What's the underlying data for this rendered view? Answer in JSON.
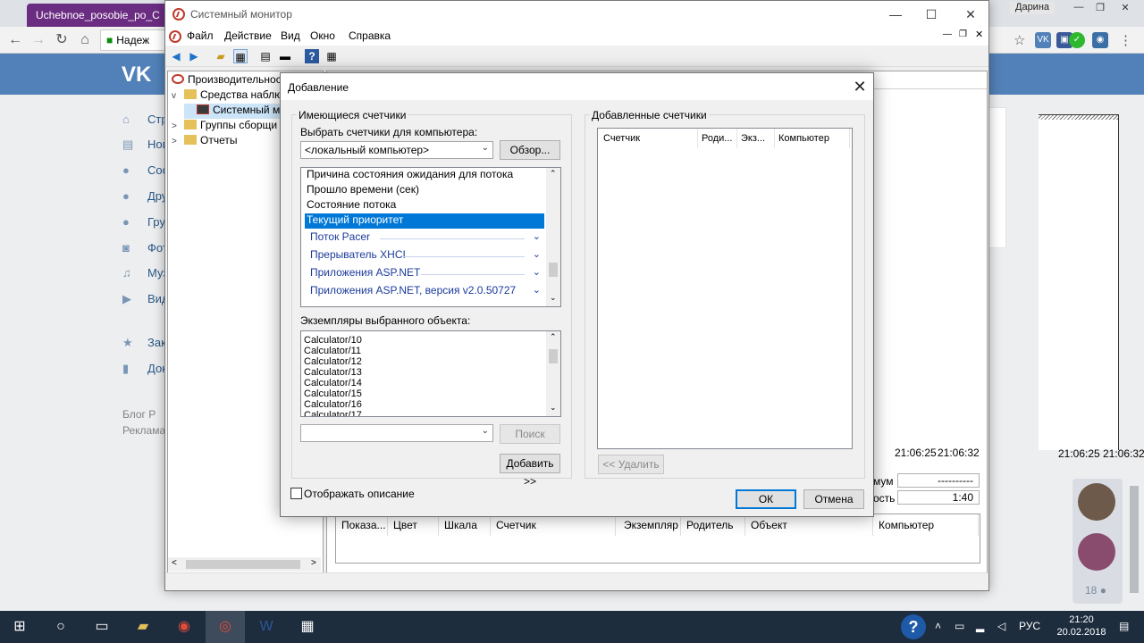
{
  "browser": {
    "tab_title": "Uchebnoe_posobie_po_C",
    "address_text": "Надеж",
    "user_name": "Дарина"
  },
  "vk": {
    "logo": "VK",
    "menu": [
      {
        "label": "Стр",
        "icon": "home-icon"
      },
      {
        "label": "Нов",
        "icon": "news-icon"
      },
      {
        "label": "Соо",
        "icon": "messages-icon"
      },
      {
        "label": "Дру",
        "icon": "friends-icon"
      },
      {
        "label": "Гру",
        "icon": "groups-icon"
      },
      {
        "label": "Фот",
        "icon": "camera-icon"
      },
      {
        "label": "Муз",
        "icon": "music-icon"
      },
      {
        "label": "Вид",
        "icon": "video-icon"
      },
      {
        "label": "Зак",
        "icon": "bookmark-icon"
      },
      {
        "label": "Док",
        "icon": "document-icon"
      }
    ],
    "footer_line1": "Блог   Р",
    "footer_line2": "Реклама",
    "friends_count": "18"
  },
  "perfmon": {
    "title": "Системный монитор",
    "menu": [
      "Файл",
      "Действие",
      "Вид",
      "Окно",
      "Справка"
    ],
    "tree": [
      {
        "label": "Производительност",
        "level": 0,
        "expander": ""
      },
      {
        "label": "Средства наблюд",
        "level": 1,
        "expander": "v"
      },
      {
        "label": "Системный м",
        "level": 2,
        "expander": ""
      },
      {
        "label": "Группы сборщи",
        "level": 1,
        "expander": ">"
      },
      {
        "label": "Отчеты",
        "level": 1,
        "expander": ">"
      }
    ],
    "graph_times": [
      "21:06:25",
      "21:06:32"
    ],
    "stats": [
      {
        "label": "мум",
        "value": "----------"
      },
      {
        "label": "ость",
        "value": "1:40"
      }
    ],
    "columns": [
      "Показа...",
      "Цвет",
      "Шкала",
      "Счетчик",
      "Экземпляр",
      "Родитель",
      "Объект",
      "Компьютер"
    ]
  },
  "dialog": {
    "title": "Добавление",
    "available_group": "Имеющиеся счетчики",
    "select_computer_label": "Выбрать счетчики для компьютера:",
    "computer_value": "<локальный компьютер>",
    "browse_button": "Обзор...",
    "counters": [
      {
        "label": "Причина состояния ожидания для потока",
        "selected": false
      },
      {
        "label": "Прошло времени (сек)",
        "selected": false
      },
      {
        "label": "Состояние потока",
        "selected": false
      },
      {
        "label": "Текущий приоритет",
        "selected": true
      }
    ],
    "categories": [
      "Поток Pacer",
      "Прерыватель XHCI",
      "Приложения ASP.NET",
      "Приложения ASP.NET, версия v2.0.50727"
    ],
    "instances_label": "Экземпляры выбранного объекта:",
    "instances": [
      "Calculator/10",
      "Calculator/11",
      "Calculator/12",
      "Calculator/13",
      "Calculator/14",
      "Calculator/15",
      "Calculator/16",
      "Calculator/17"
    ],
    "search_value": "",
    "search_button": "Поиск",
    "add_button": "Добавить >>",
    "added_group": "Добавленные счетчики",
    "added_columns": [
      "Счетчик",
      "Роди...",
      "Экз...",
      "Компьютер"
    ],
    "remove_button": "<< Удалить",
    "show_description": "Отображать описание",
    "show_description_checked": false,
    "ok_button": "ОК",
    "cancel_button": "Отмена"
  },
  "taskbar": {
    "language": "РУС",
    "time": "21:20",
    "date": "20.02.2018"
  }
}
